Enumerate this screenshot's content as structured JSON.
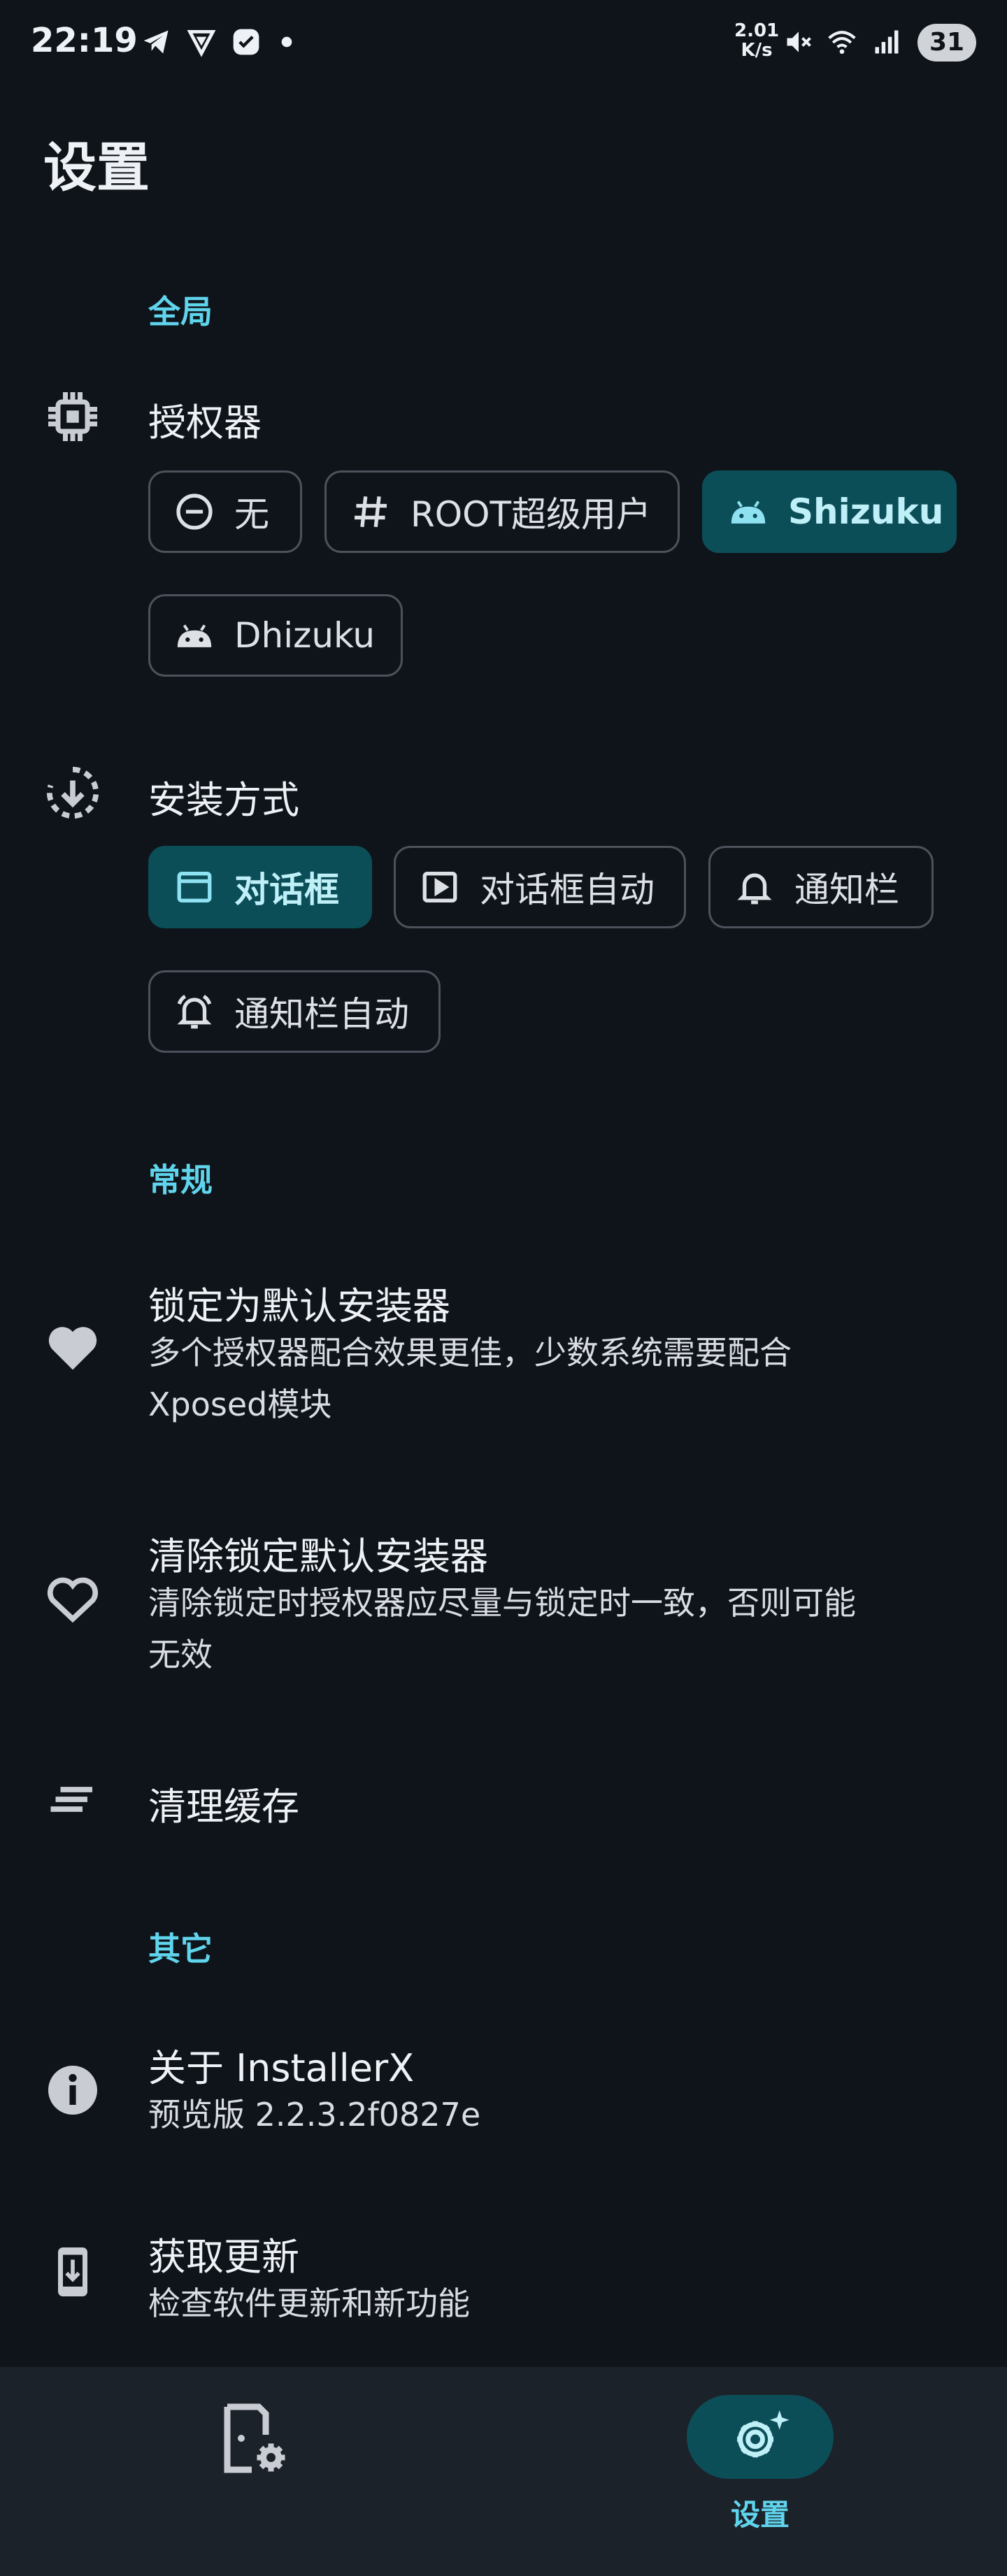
{
  "status_bar": {
    "time": "22:19",
    "net_speed_value": "2.01",
    "net_speed_unit": "K/s",
    "battery": "31"
  },
  "page": {
    "title": "设置"
  },
  "sections": {
    "global": "全局",
    "general": "常规",
    "other": "其它"
  },
  "authorizer": {
    "title": "授权器",
    "icon": "chip-icon",
    "options": [
      {
        "label": "无",
        "icon": "minus-circle-icon",
        "selected": false
      },
      {
        "label": "ROOT超级用户",
        "icon": "hash-icon",
        "selected": false
      },
      {
        "label": "Shizuku",
        "icon": "android-icon",
        "selected": true
      },
      {
        "label": "Dhizuku",
        "icon": "android-icon",
        "selected": false
      }
    ]
  },
  "install_mode": {
    "title": "安装方式",
    "icon": "download-circle-icon",
    "options": [
      {
        "label": "对话框",
        "icon": "window-icon",
        "selected": true
      },
      {
        "label": "对话框自动",
        "icon": "play-box-icon",
        "selected": false
      },
      {
        "label": "通知栏",
        "icon": "bell-icon",
        "selected": false
      },
      {
        "label": "通知栏自动",
        "icon": "bell-ring-icon",
        "selected": false
      }
    ]
  },
  "lock_default": {
    "title": "锁定为默认安装器",
    "subtitle_line1": "多个授权器配合效果更佳，少数系统需要配合",
    "subtitle_line2": "Xposed模块",
    "icon": "heart-filled-icon"
  },
  "clear_lock": {
    "title": "清除锁定默认安装器",
    "subtitle_line1": "清除锁定时授权器应尽量与锁定时一致，否则可能",
    "subtitle_line2": "无效",
    "icon": "heart-outline-icon"
  },
  "clear_cache": {
    "title": "清理缓存",
    "icon": "clear-all-icon"
  },
  "about": {
    "title": "关于 InstallerX",
    "subtitle": "预览版 2.2.3.2f0827e",
    "icon": "info-icon"
  },
  "update": {
    "title": "获取更新",
    "subtitle": "检查软件更新和新功能",
    "icon": "phone-download-icon"
  },
  "bottom_nav": {
    "home_icon": "app-settings-icon",
    "settings_icon": "settings-sparkle-icon",
    "settings_label": "设置"
  },
  "colors": {
    "background": "#0f141a",
    "accent": "#5fd4ec",
    "selected_chip": "#0c4e58",
    "nav_bar": "#1c222a"
  }
}
